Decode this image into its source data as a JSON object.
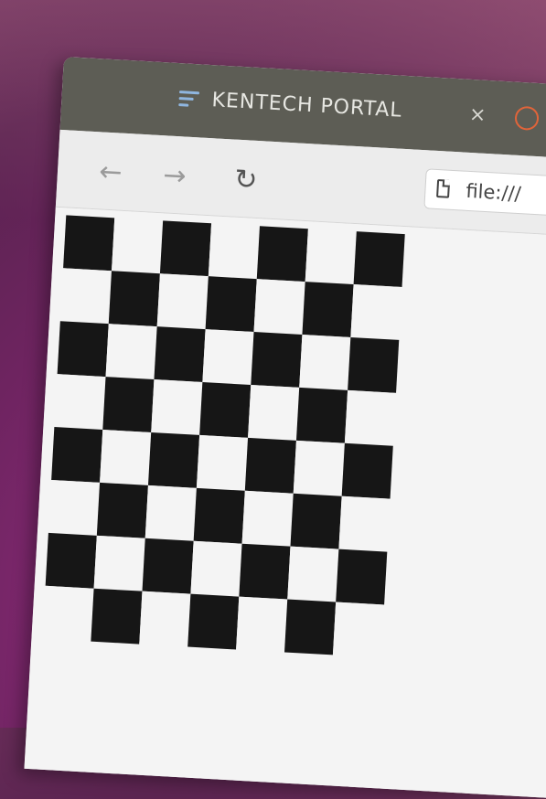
{
  "window": {
    "title": "KENTECH PORTAL",
    "close_label": "×"
  },
  "toolbar": {
    "back_label": "←",
    "forward_label": "→",
    "reload_label": "↻",
    "url": "file:///"
  },
  "board": {
    "rows": 8,
    "cols": 7,
    "pattern": "checkerboard",
    "dark_color": "#161616",
    "light_color": "#f4f4f4"
  },
  "icons": {
    "app": "menu-lines-icon",
    "close": "close-icon",
    "back": "arrow-left-icon",
    "forward": "arrow-right-icon",
    "reload": "reload-icon",
    "file": "document-icon"
  },
  "colors": {
    "titlebar": "#5d5d55",
    "accent_orange": "#e0643a",
    "app_icon_blue": "#8fb6e0"
  }
}
